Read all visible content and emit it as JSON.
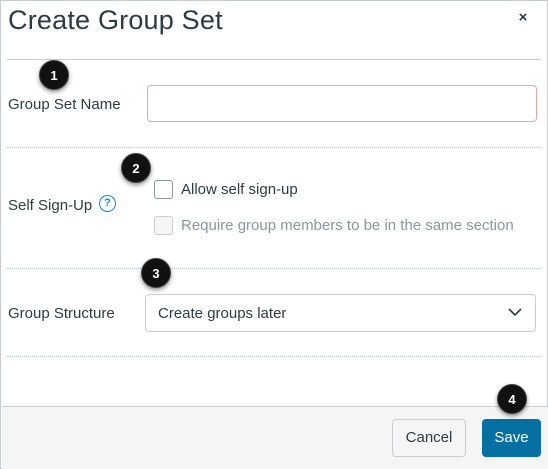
{
  "dialog": {
    "title": "Create Group Set",
    "close_label": "×"
  },
  "fields": {
    "group_set_name": {
      "label": "Group Set Name",
      "value": "",
      "placeholder": ""
    },
    "self_signup": {
      "label": "Self Sign-Up",
      "help_icon": "?",
      "options": [
        {
          "label": "Allow self sign-up",
          "checked": false,
          "disabled": false
        },
        {
          "label": "Require group members to be in the same section",
          "checked": false,
          "disabled": true
        }
      ]
    },
    "group_structure": {
      "label": "Group Structure",
      "selected": "Create groups later"
    }
  },
  "footer": {
    "cancel_label": "Cancel",
    "save_label": "Save"
  },
  "callouts": [
    "1",
    "2",
    "3",
    "4"
  ],
  "icons": {
    "close": "close-icon",
    "help": "question-circle-icon",
    "dropdown": "chevron-down-icon"
  },
  "colors": {
    "primary": "#0770a3",
    "link": "#008ee2",
    "error_border": "#f2a4a4",
    "text": "#2d3b45"
  }
}
